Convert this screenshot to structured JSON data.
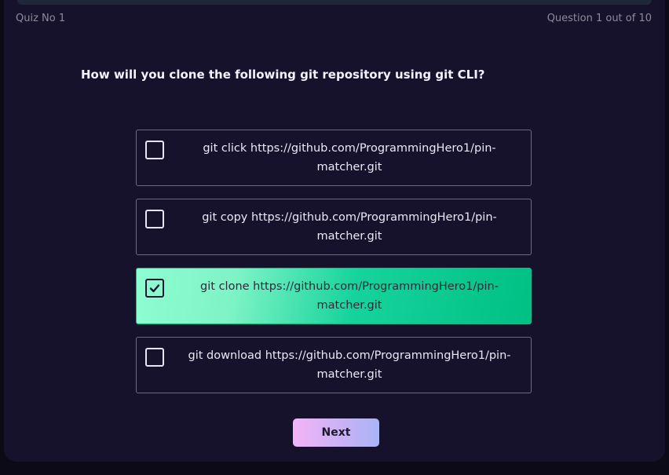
{
  "quiz": {
    "title": "Quiz No 1",
    "progress": "Question 1 out of 10"
  },
  "question": {
    "text": "How will you clone the following git repository using git CLI?"
  },
  "options": [
    {
      "label": "git click https://github.com/ProgrammingHero1/pin-matcher.git",
      "checked": false
    },
    {
      "label": "git copy https://github.com/ProgrammingHero1/pin-matcher.git",
      "checked": false
    },
    {
      "label": "git clone https://github.com/ProgrammingHero1/pin-matcher.git",
      "checked": true
    },
    {
      "label": "git download https://github.com/ProgrammingHero1/pin-matcher.git",
      "checked": false
    }
  ],
  "actions": {
    "next_label": "Next"
  },
  "colors": {
    "background": "#17122b",
    "selected_accent": "#00c487",
    "button_gradient_start": "#f3b5f7",
    "button_gradient_end": "#a9b4f7"
  },
  "icons": {
    "checked": "check-icon"
  }
}
